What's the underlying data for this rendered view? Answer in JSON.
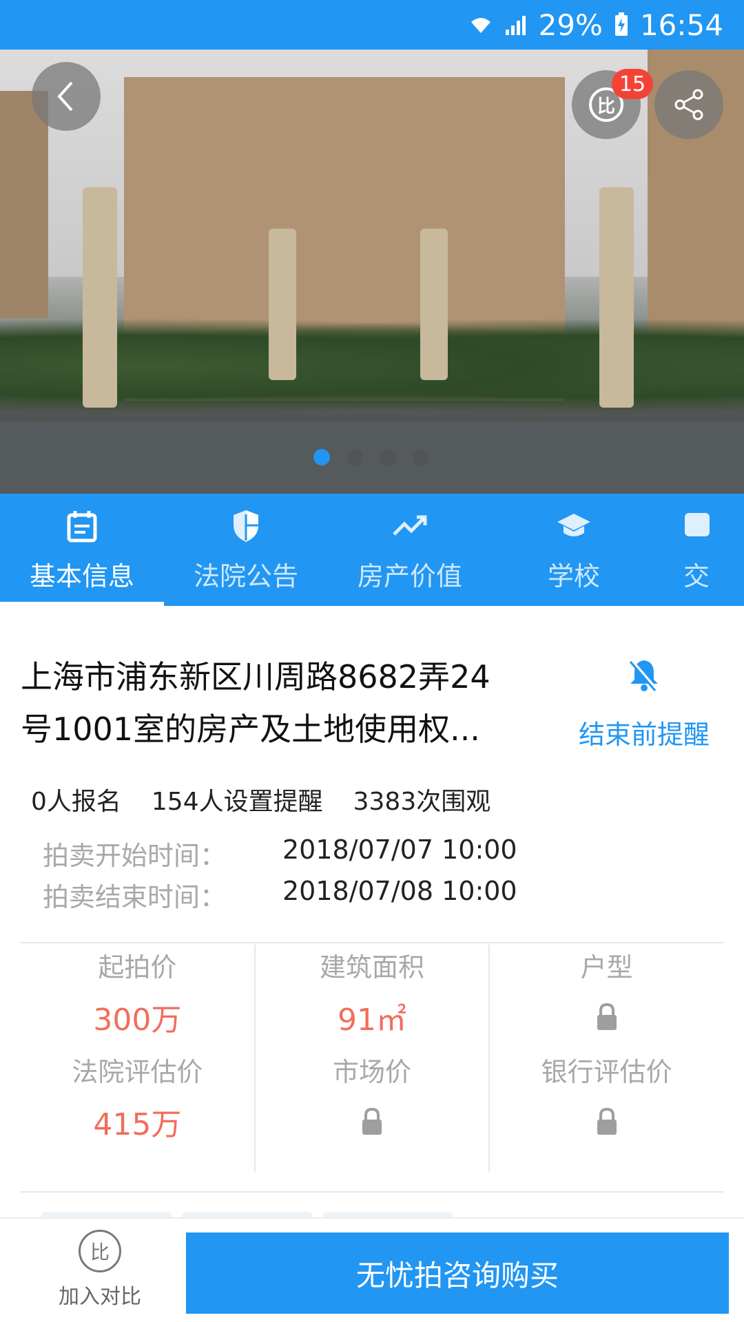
{
  "status_bar": {
    "battery": "29%",
    "time": "16:54"
  },
  "hero": {
    "compare_badge": "15",
    "compare_glyph": "比",
    "carousel_total": 4,
    "carousel_active": 1
  },
  "tabs": [
    {
      "label": "基本信息",
      "icon": "calendar-icon",
      "active": true
    },
    {
      "label": "法院公告",
      "icon": "shield-icon",
      "active": false
    },
    {
      "label": "房产价值",
      "icon": "trending-up-icon",
      "active": false
    },
    {
      "label": "学校",
      "icon": "school-icon",
      "active": false
    },
    {
      "label": "交",
      "icon": "chat-icon",
      "active": false
    }
  ],
  "listing": {
    "title_line1": "上海市浦东新区川周路8682弄24",
    "title_line2": "号1001室的房产及土地使用权...",
    "remind_label": "结束前提醒",
    "stats": {
      "signups": "0人报名",
      "reminders": "154人设置提醒",
      "views": "3383次围观"
    },
    "start_label": "拍卖开始时间：",
    "start_value": "2018/07/07 10:00",
    "end_label": "拍卖结束时间：",
    "end_value": "2018/07/08 10:00"
  },
  "info_grid": {
    "starting_price_label": "起拍价",
    "starting_price_value": "300万",
    "area_label": "建筑面积",
    "area_value": "91㎡",
    "layout_label": "户型",
    "court_valuation_label": "法院评估价",
    "court_valuation_value": "415万",
    "market_price_label": "市场价",
    "bank_valuation_label": "银行评估价"
  },
  "bottom_bar": {
    "compare_glyph": "比",
    "compare_label": "加入对比",
    "buy_label": "无忧拍咨询购买"
  },
  "colors": {
    "accent": "#2196f3",
    "price": "#f26d5b",
    "badge": "#f44336",
    "muted": "#a8a8a8"
  }
}
